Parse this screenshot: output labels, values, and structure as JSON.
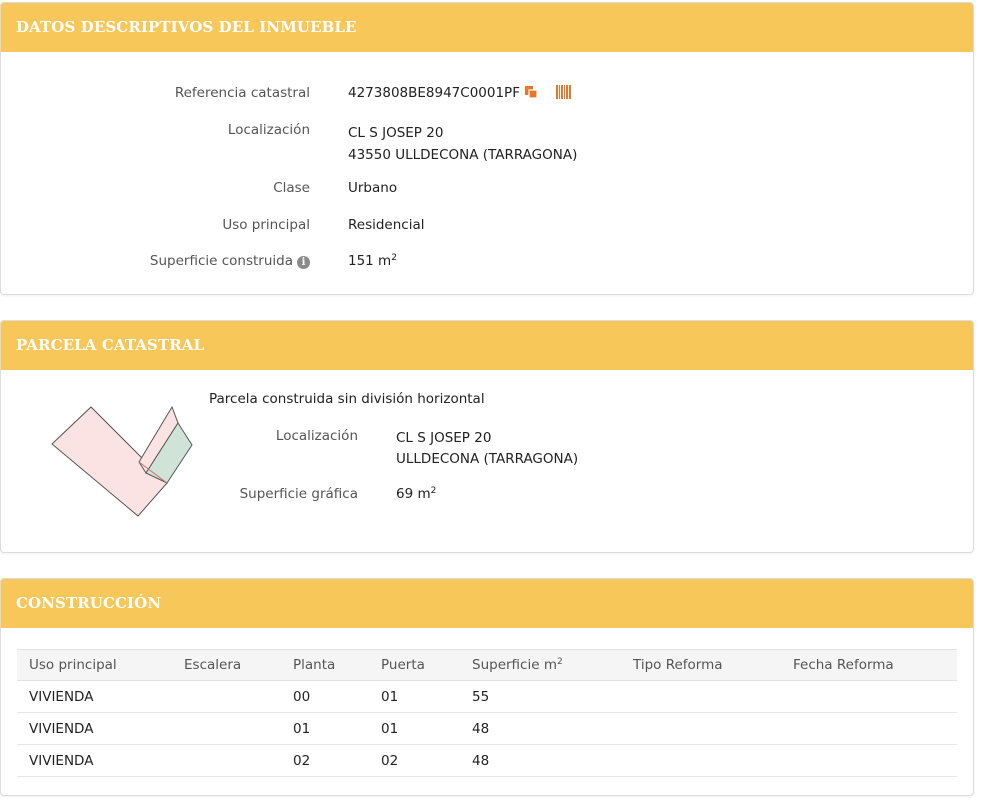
{
  "descriptivos": {
    "title": "DATOS DESCRIPTIVOS DEL INMUEBLE",
    "ref_label": "Referencia catastral",
    "ref_value": "4273808BE8947C0001PF",
    "loc_label": "Localización",
    "loc_line1": "CL S JOSEP 20",
    "loc_line2": "43550 ULLDECONA (TARRAGONA)",
    "clase_label": "Clase",
    "clase_value": "Urbano",
    "uso_label": "Uso principal",
    "uso_value": "Residencial",
    "sup_label": "Superficie construida",
    "sup_value": "151 m",
    "sup_unit_exp": "2"
  },
  "parcela": {
    "title": "PARCELA CATASTRAL",
    "subtitle": "Parcela construida sin división horizontal",
    "loc_label": "Localización",
    "loc_line1": "CL S JOSEP 20",
    "loc_line2": "ULLDECONA (TARRAGONA)",
    "sup_label": "Superficie gráfica",
    "sup_value": "69 m",
    "sup_unit_exp": "2"
  },
  "construccion": {
    "title": "CONSTRUCCIÓN",
    "headers": {
      "uso": "Uso principal",
      "escalera": "Escalera",
      "planta": "Planta",
      "puerta": "Puerta",
      "superficie": "Superficie m",
      "superficie_exp": "2",
      "tipo_reforma": "Tipo Reforma",
      "fecha_reforma": "Fecha Reforma"
    },
    "rows": [
      {
        "uso": "VIVIENDA",
        "escalera": "",
        "planta": "00",
        "puerta": "01",
        "superficie": "55",
        "tipo_reforma": "",
        "fecha_reforma": ""
      },
      {
        "uso": "VIVIENDA",
        "escalera": "",
        "planta": "01",
        "puerta": "01",
        "superficie": "48",
        "tipo_reforma": "",
        "fecha_reforma": ""
      },
      {
        "uso": "VIVIENDA",
        "escalera": "",
        "planta": "02",
        "puerta": "02",
        "superficie": "48",
        "tipo_reforma": "",
        "fecha_reforma": ""
      }
    ]
  },
  "icons": {
    "copy": "copy-icon",
    "barcode": "barcode-icon",
    "info": "info-icon"
  },
  "colors": {
    "header_bg": "#f8c75a",
    "icon_orange": "#e8762b",
    "parcel_fill": "#fbe3e3",
    "parcel_green": "#cfe3d6"
  }
}
